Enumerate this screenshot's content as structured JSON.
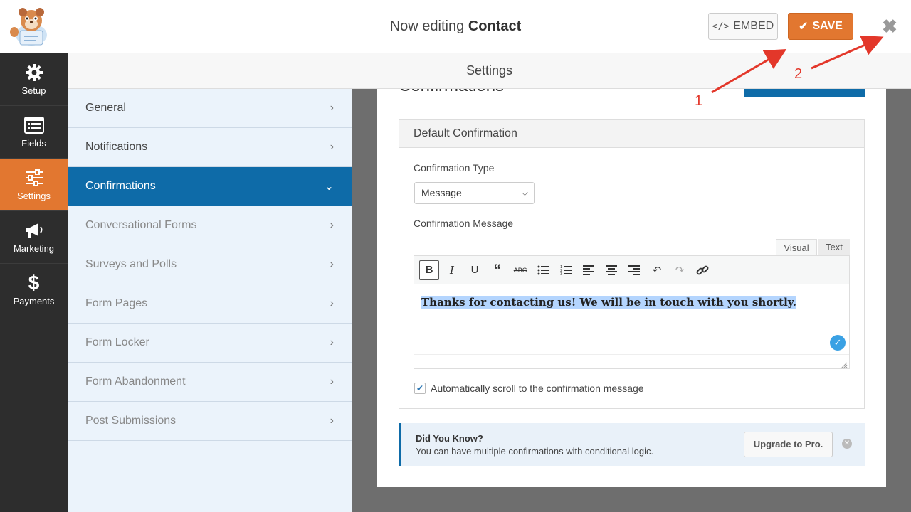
{
  "header": {
    "title_prefix": "Now editing",
    "title_form": "Contact",
    "embed_label": "EMBED",
    "save_label": "SAVE"
  },
  "leftnav": {
    "items": [
      {
        "label": "Setup",
        "icon": "gear-icon"
      },
      {
        "label": "Fields",
        "icon": "fields-icon"
      },
      {
        "label": "Settings",
        "icon": "sliders-icon"
      },
      {
        "label": "Marketing",
        "icon": "megaphone-icon"
      },
      {
        "label": "Payments",
        "icon": "dollar-icon"
      }
    ],
    "active": "Settings"
  },
  "settings_header": "Settings",
  "panel": {
    "items": [
      {
        "label": "General"
      },
      {
        "label": "Notifications"
      },
      {
        "label": "Confirmations"
      },
      {
        "label": "Conversational Forms"
      },
      {
        "label": "Surveys and Polls"
      },
      {
        "label": "Form Pages"
      },
      {
        "label": "Form Locker"
      },
      {
        "label": "Form Abandonment"
      },
      {
        "label": "Post Submissions"
      }
    ],
    "active": "Confirmations"
  },
  "content": {
    "heading": "Confirmations",
    "box_title": "Default Confirmation",
    "type_label": "Confirmation Type",
    "type_value": "Message",
    "message_label": "Confirmation Message",
    "tab_visual": "Visual",
    "tab_text": "Text",
    "message_text": "Thanks for contacting us! We will be in touch with you shortly.",
    "auto_scroll_label": "Automatically scroll to the confirmation message",
    "auto_scroll_checked": true
  },
  "notice": {
    "title": "Did You Know?",
    "text": "You can have multiple confirmations with conditional logic.",
    "button": "Upgrade to Pro."
  },
  "annotations": {
    "one": "1",
    "two": "2"
  },
  "colors": {
    "accent": "#e27730",
    "primary": "#0e6ba8",
    "nav_bg": "#2d2d2d",
    "panel_bg": "#ebf3fb",
    "annotation": "#e3372a"
  }
}
